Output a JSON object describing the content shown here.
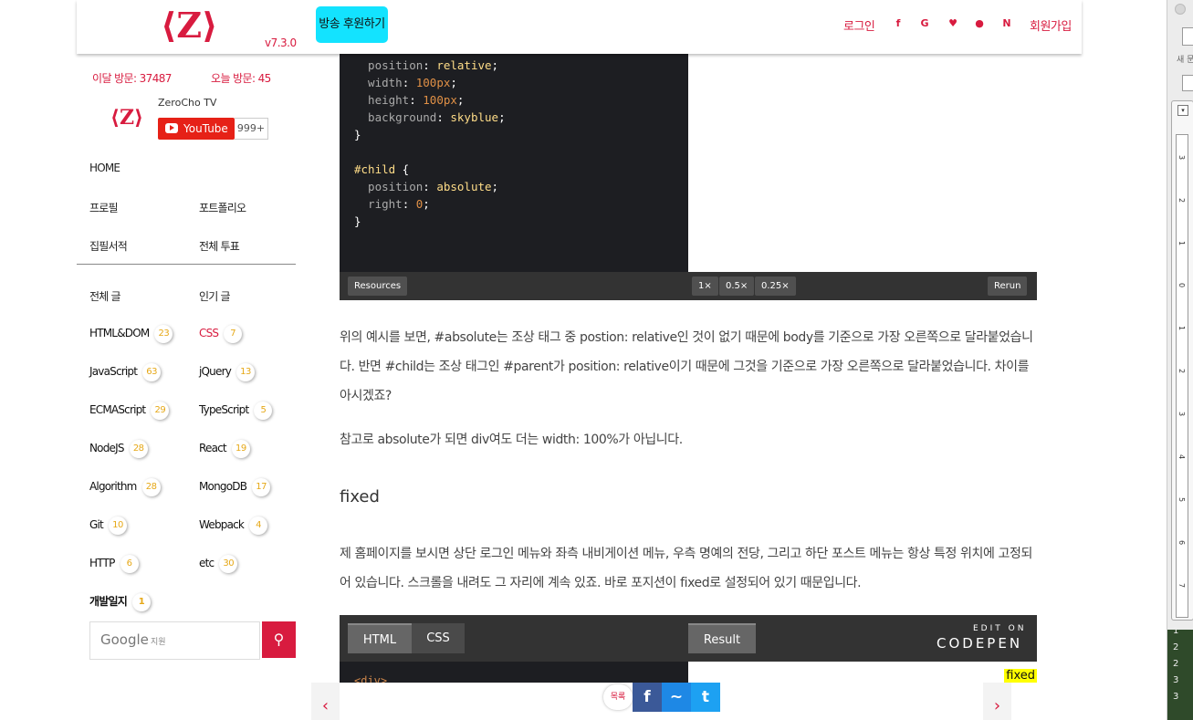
{
  "header": {
    "logo": "⟨Z⟩",
    "version": "v7.3.0",
    "donate_label": "방송 후원하기",
    "login_label": "로그인",
    "social_icons": [
      "facebook-icon",
      "google-icon",
      "github-icon",
      "kakao-icon",
      "naver-icon"
    ],
    "signup_label": "회원가입"
  },
  "sidebar": {
    "monthly_visits": "이달 방문: 37487",
    "today_visits": "오늘 방문: 45",
    "channel_logo": "⟨Z⟩",
    "channel_name": "ZeroCho TV",
    "youtube_label": "YouTube",
    "subscriber_count": "999+",
    "nav": {
      "home": "HOME",
      "profile": "프로필",
      "portfolio": "포트폴리오",
      "books": "집필서적",
      "polls": "전체 투표"
    },
    "all_posts": "전체 글",
    "popular_posts": "인기 글",
    "categories": [
      {
        "label": "HTML&DOM",
        "count": "23"
      },
      {
        "label": "CSS",
        "count": "7"
      },
      {
        "label": "JavaScript",
        "count": "63"
      },
      {
        "label": "jQuery",
        "count": "13"
      },
      {
        "label": "ECMAScript",
        "count": "29"
      },
      {
        "label": "TypeScript",
        "count": "5"
      },
      {
        "label": "NodeJS",
        "count": "28"
      },
      {
        "label": "React",
        "count": "19"
      },
      {
        "label": "Algorithm",
        "count": "28"
      },
      {
        "label": "MongoDB",
        "count": "17"
      },
      {
        "label": "Git",
        "count": "10"
      },
      {
        "label": "Webpack",
        "count": "4"
      },
      {
        "label": "HTTP",
        "count": "6"
      },
      {
        "label": "etc",
        "count": "30"
      },
      {
        "label": "개발일지",
        "count": "1"
      }
    ],
    "search": {
      "brand": "Google",
      "placeholder": "지원"
    }
  },
  "codepen1": {
    "buttons": {
      "resources": "Resources",
      "zoom_1": "1×",
      "zoom_05": "0.5×",
      "zoom_025": "0.25×",
      "rerun": "Rerun"
    }
  },
  "article": {
    "para1": "위의 예시를 보면, #absolute는 조상 태그 중 postion: relative인 것이 없기 때문에 body를 기준으로 가장 오른쪽으로 달라붙었습니다. 반면 #child는 조상 태그인 #parent가 position: relative이기 때문에 그것을 기준으로 가장 오른쪽으로 달라붙었습니다. 차이를 아시겠죠?",
    "para2": "참고로 absolute가 되면 div여도 더는 width: 100%가 아닙니다.",
    "heading_fixed": "fixed",
    "para3": "제 홈페이지를 보시면 상단 로그인 메뉴와 좌측 내비게이션 메뉴, 우측 명예의 전당, 그리고 하단 포스트 메뉴는 항상 특정 위치에 고정되어 있습니다. 스크롤을 내려도 그 자리에 계속 있죠. 바로 포지션이 fixed로 설정되어 있기 때문입니다."
  },
  "codepen2": {
    "tab_html": "HTML",
    "tab_css": "CSS",
    "tab_result": "Result",
    "brand_top": "EDIT ON",
    "brand": "CODEPEN",
    "code_snippet": "<div>",
    "result_tag": "fixed"
  },
  "bottom_nav": {
    "prev_arrow": "‹",
    "next_arrow": "›",
    "list_label": "목록",
    "share_icons": [
      "facebook-share-icon",
      "messenger-share-icon",
      "twitter-share-icon"
    ]
  },
  "right_panel": {
    "label": "새 문",
    "dropdown": "▾",
    "ruler_numbers": [
      "3",
      "2",
      "1",
      "0",
      "1",
      "2",
      "3",
      "4",
      "5",
      "6",
      "7"
    ],
    "bottom_numbers": [
      "1",
      "2",
      "2",
      "3",
      "3"
    ]
  },
  "colors": {
    "accent": "#d81b3f",
    "donate_bg": "#13e3ff",
    "badge_text": "#e6a817",
    "codepen_bg": "#1d1e22",
    "facebook": "#3b5998",
    "messenger": "#1e88e5",
    "twitter": "#1da1f2"
  }
}
